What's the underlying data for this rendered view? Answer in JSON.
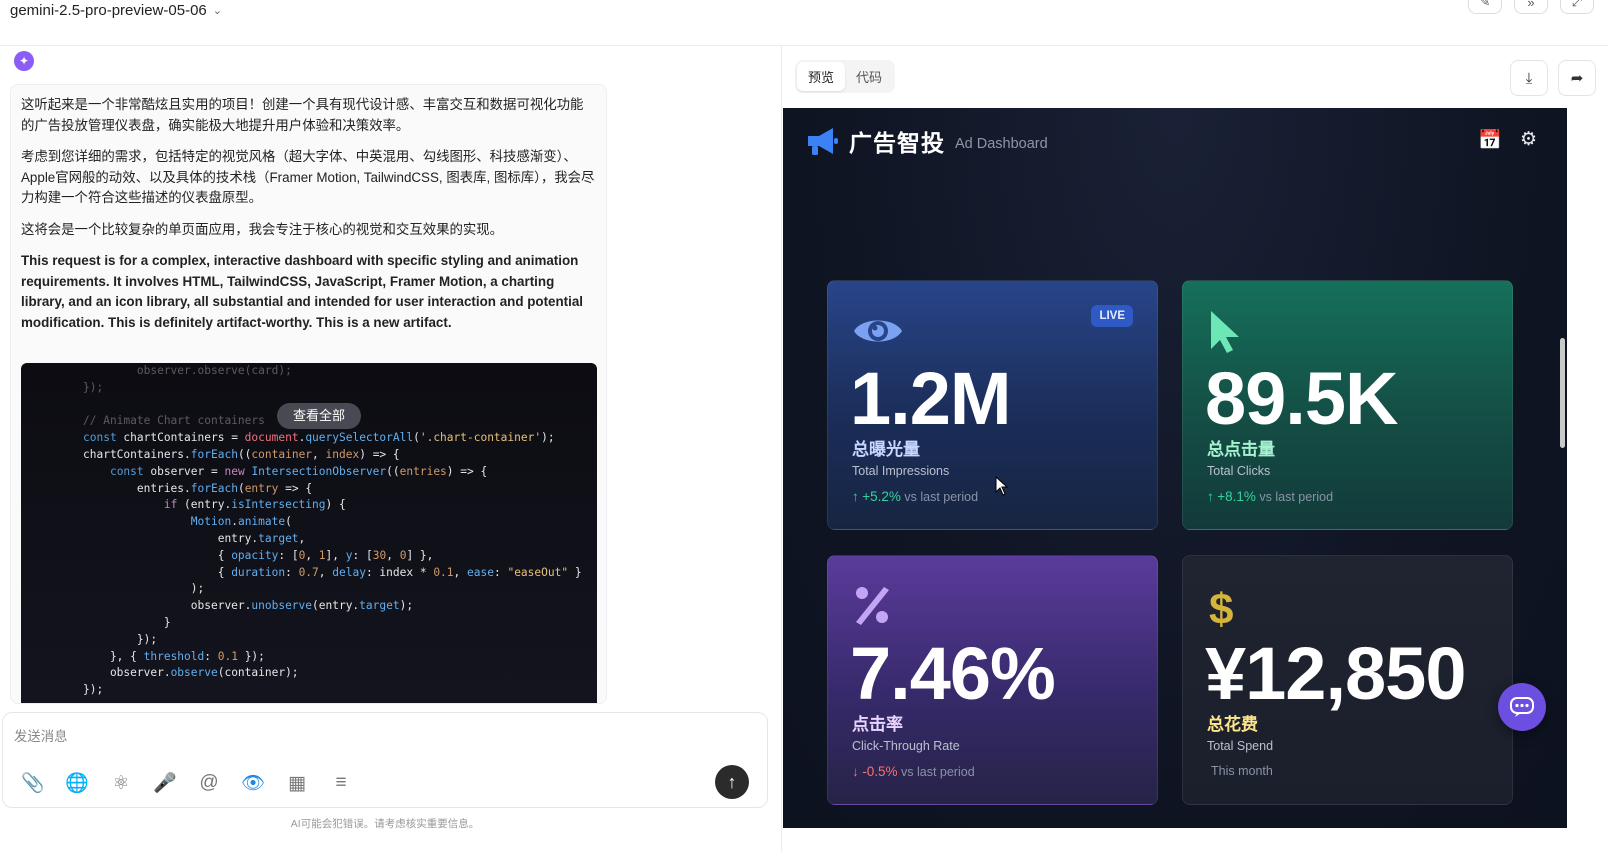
{
  "topbar": {
    "model": "gemini-2.5-pro-preview-05-06",
    "actions": [
      "edit-icon",
      "fast-forward-icon",
      "collapse-icon"
    ]
  },
  "chat": {
    "paragraphs": [
      "这听起来是一个非常酷炫且实用的项目！创建一个具有现代设计感、丰富交互和数据可视化功能的广告投放管理仪表盘，确实能极大地提升用户体验和决策效率。",
      "考虑到您详细的需求，包括特定的视觉风格（超大字体、中英混用、勾线图形、科技感渐变）、Apple官网般的动效、以及具体的技术栈（Framer Motion, TailwindCSS, 图表库, 图标库），我会尽力构建一个符合这些描述的仪表盘原型。",
      "这将会是一个比较复杂的单页面应用，我会专注于核心的视觉和交互效果的实现。",
      "This request is for a complex, interactive dashboard with specific styling and animation requirements. It involves HTML, TailwindCSS, JavaScript, Framer Motion, a charting library, and an icon library, all substantial and intended for user interaction and potential modification. This is definitely artifact-worthy. This is a new artifact."
    ],
    "view_all": "查看全部",
    "input_placeholder": "发送消息",
    "disclaimer": "AI可能会犯错误。请考虑核实重要信息。"
  },
  "preview": {
    "tabs": [
      "预览",
      "代码"
    ],
    "active_tab": 0
  },
  "dashboard": {
    "title": "广告智投",
    "subtitle": "Ad Dashboard",
    "cards": [
      {
        "value": "1.2M",
        "zh": "总曝光量",
        "en": "Total Impressions",
        "trend_arrow": "↑",
        "trend_value": "+5.2%",
        "trend_label": "vs last period",
        "badge": "LIVE",
        "icon": "eye-icon"
      },
      {
        "value": "89.5K",
        "zh": "总点击量",
        "en": "Total Clicks",
        "trend_arrow": "↑",
        "trend_value": "+8.1%",
        "trend_label": "vs last period",
        "icon": "cursor-icon"
      },
      {
        "value": "7.46%",
        "zh": "点击率",
        "en": "Click-Through Rate",
        "trend_arrow": "↓",
        "trend_value": "-0.5%",
        "trend_label": "vs last period",
        "icon": "percent-icon"
      },
      {
        "value": "¥12,850",
        "zh": "总花费",
        "en": "Total Spend",
        "trend_label": "This month",
        "icon": "dollar-icon"
      }
    ]
  },
  "colors": {
    "impressions": "#28458a",
    "clicks": "#15705a",
    "ctr": "#5a3b9b",
    "spend_accent": "#d4b43a",
    "up": "#34d399",
    "down": "#f87171"
  }
}
